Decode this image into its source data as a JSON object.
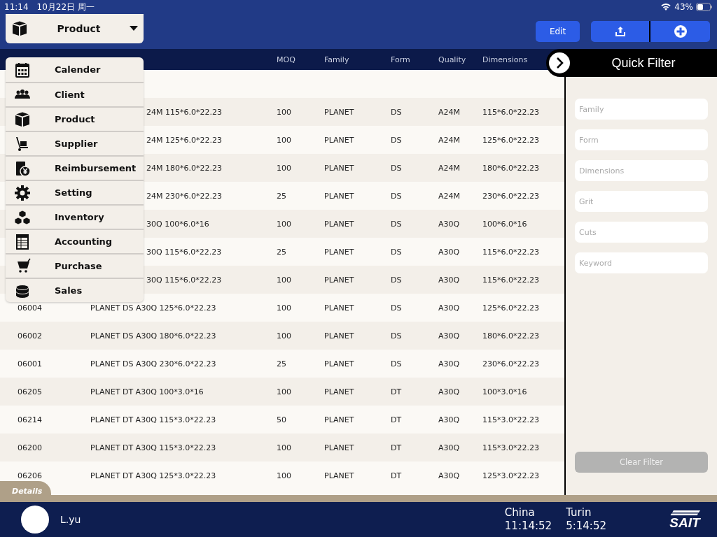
{
  "status_bar": {
    "time": "11:14",
    "date": "10月22日 周一",
    "battery": "43%"
  },
  "module_picker": {
    "label": "Product"
  },
  "toolbar": {
    "edit": "Edit"
  },
  "table": {
    "columns": [
      "MOQ",
      "Family",
      "Form",
      "Quality",
      "Dimensions"
    ],
    "rows": [
      {
        "description": "24M 115*6.0*22.23",
        "moq": "100",
        "family": "PLANET",
        "form": "DS",
        "quality": "A24M",
        "dimensions": "115*6.0*22.23"
      },
      {
        "description": "24M 125*6.0*22.23",
        "moq": "100",
        "family": "PLANET",
        "form": "DS",
        "quality": "A24M",
        "dimensions": "125*6.0*22.23"
      },
      {
        "description": "24M 180*6.0*22.23",
        "moq": "100",
        "family": "PLANET",
        "form": "DS",
        "quality": "A24M",
        "dimensions": "180*6.0*22.23"
      },
      {
        "description": "24M 230*6.0*22.23",
        "moq": "25",
        "family": "PLANET",
        "form": "DS",
        "quality": "A24M",
        "dimensions": "230*6.0*22.23"
      },
      {
        "description": "30Q 100*6.0*16",
        "moq": "100",
        "family": "PLANET",
        "form": "DS",
        "quality": "A30Q",
        "dimensions": "100*6.0*16"
      },
      {
        "description": "30Q 115*6.0*22.23",
        "moq": "25",
        "family": "PLANET",
        "form": "DS",
        "quality": "A30Q",
        "dimensions": "115*6.0*22.23"
      },
      {
        "description": "30Q 115*6.0*22.23",
        "moq": "100",
        "family": "PLANET",
        "form": "DS",
        "quality": "A30Q",
        "dimensions": "115*6.0*22.23"
      },
      {
        "item_code": "06004",
        "description": "PLANET DS A30Q 125*6.0*22.23",
        "moq": "100",
        "family": "PLANET",
        "form": "DS",
        "quality": "A30Q",
        "dimensions": "125*6.0*22.23"
      },
      {
        "item_code": "06002",
        "description": "PLANET DS A30Q 180*6.0*22.23",
        "moq": "100",
        "family": "PLANET",
        "form": "DS",
        "quality": "A30Q",
        "dimensions": "180*6.0*22.23"
      },
      {
        "item_code": "06001",
        "description": "PLANET DS A30Q 230*6.0*22.23",
        "moq": "25",
        "family": "PLANET",
        "form": "DS",
        "quality": "A30Q",
        "dimensions": "230*6.0*22.23"
      },
      {
        "item_code": "06205",
        "description": "PLANET DT A30Q 100*3.0*16",
        "moq": "100",
        "family": "PLANET",
        "form": "DT",
        "quality": "A30Q",
        "dimensions": "100*3.0*16"
      },
      {
        "item_code": "06214",
        "description": "PLANET DT A30Q 115*3.0*22.23",
        "moq": "50",
        "family": "PLANET",
        "form": "DT",
        "quality": "A30Q",
        "dimensions": "115*3.0*22.23"
      },
      {
        "item_code": "06200",
        "description": "PLANET DT A30Q 115*3.0*22.23",
        "moq": "100",
        "family": "PLANET",
        "form": "DT",
        "quality": "A30Q",
        "dimensions": "115*3.0*22.23"
      },
      {
        "item_code": "06206",
        "description": "PLANET DT A30Q 125*3.0*22.23",
        "moq": "100",
        "family": "PLANET",
        "form": "DT",
        "quality": "A30Q",
        "dimensions": "125*3.0*22.23"
      }
    ]
  },
  "menu": {
    "items": [
      {
        "kind": "calendar",
        "label": "Calender"
      },
      {
        "kind": "client",
        "label": "Client"
      },
      {
        "kind": "product",
        "label": "Product"
      },
      {
        "kind": "supplier",
        "label": "Supplier"
      },
      {
        "kind": "reimbursement",
        "label": "Reimbursement"
      },
      {
        "kind": "setting",
        "label": "Setting"
      },
      {
        "kind": "inventory",
        "label": "Inventory"
      },
      {
        "kind": "accounting",
        "label": "Accounting"
      },
      {
        "kind": "purchase",
        "label": "Purchase"
      },
      {
        "kind": "sales",
        "label": "Sales"
      }
    ]
  },
  "quick_filter": {
    "title": "Quick Filter",
    "fields": [
      {
        "placeholder": "Family"
      },
      {
        "placeholder": "Form"
      },
      {
        "placeholder": "Dimensions"
      },
      {
        "placeholder": "Grit"
      },
      {
        "placeholder": "Cuts"
      },
      {
        "placeholder": "Keyword"
      }
    ],
    "clear_button": {
      "label": "Clear Filter",
      "disabled": true
    }
  },
  "details_tab": "Details",
  "footer": {
    "user": "L.yu",
    "clocks": [
      {
        "city": "China",
        "time": "11:14:52"
      },
      {
        "city": "Turin",
        "time": "5:14:52"
      }
    ],
    "logo": "SAIT"
  }
}
